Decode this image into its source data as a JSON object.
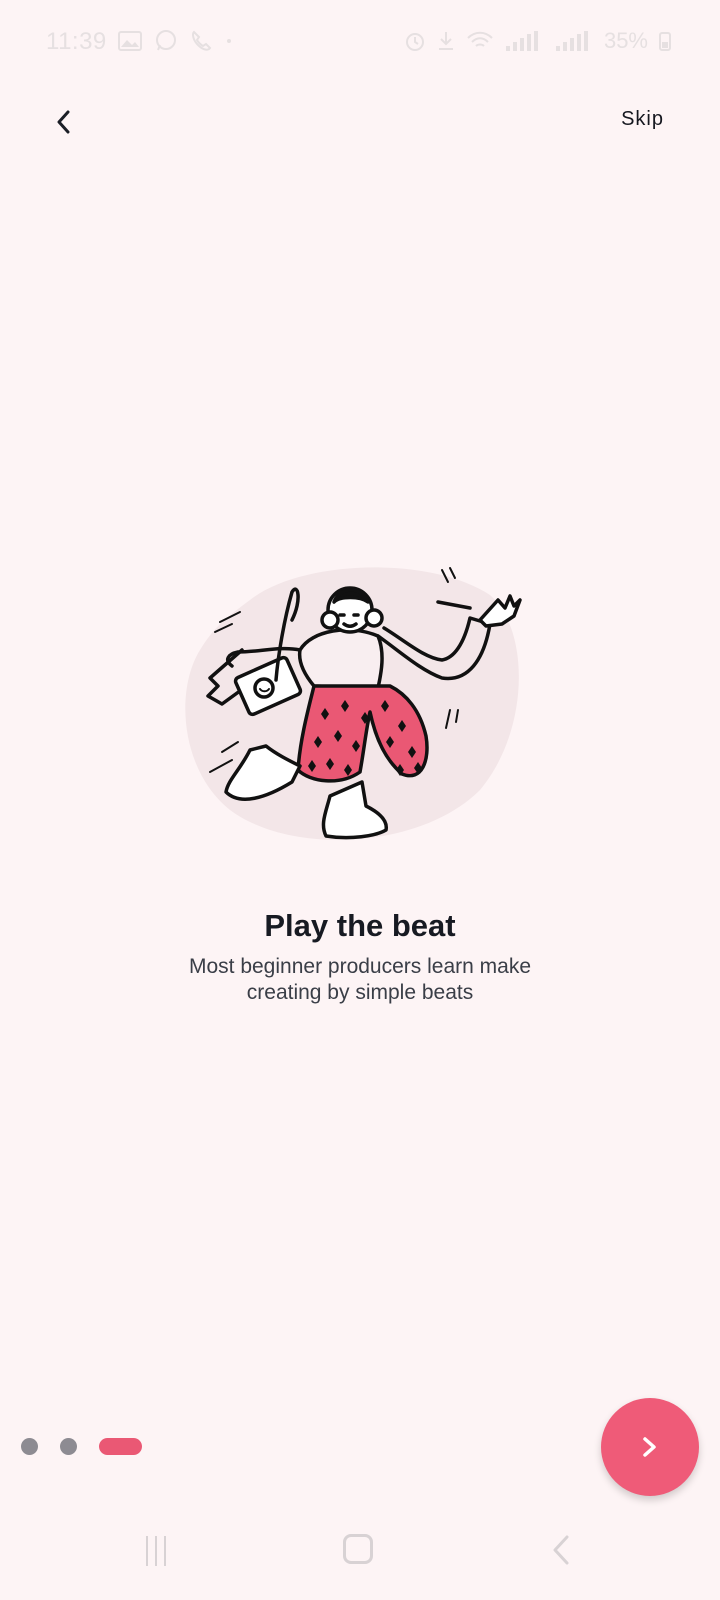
{
  "status_bar": {
    "time": "11:39",
    "battery": "35%"
  },
  "header": {
    "skip_label": "Skip"
  },
  "onboarding": {
    "title": "Play the beat",
    "subtitle": "Most beginner producers learn make creating by simple beats"
  },
  "icons": {
    "back": "chevron-left-icon",
    "next": "chevron-right-icon"
  },
  "colors": {
    "accent": "#ef5b78",
    "dot_inactive": "#8d8b92",
    "background": "#fdf4f5",
    "blob": "#f3e6e8"
  },
  "pagination": {
    "active_index": 3,
    "total": 3
  }
}
